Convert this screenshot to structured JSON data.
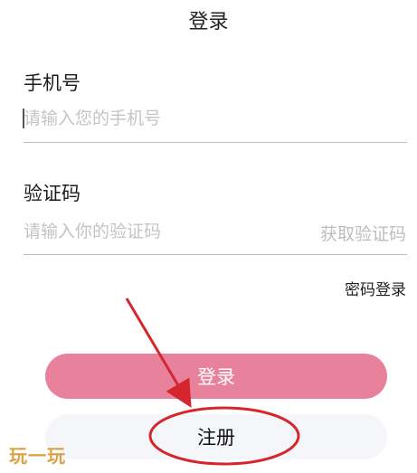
{
  "header": {
    "title": "登录"
  },
  "phone": {
    "label": "手机号",
    "placeholder": "请输入您的手机号",
    "value": ""
  },
  "code": {
    "label": "验证码",
    "placeholder": "请输入你的验证码",
    "value": "",
    "get_code_label": "获取验证码"
  },
  "password_login_label": "密码登录",
  "login_button_label": "登录",
  "register_button_label": "注册",
  "watermark": "玩一玩",
  "colors": {
    "primary_button": "#e8829c",
    "annotation": "#d4262c",
    "secondary_button_bg": "#f4f6fa"
  }
}
